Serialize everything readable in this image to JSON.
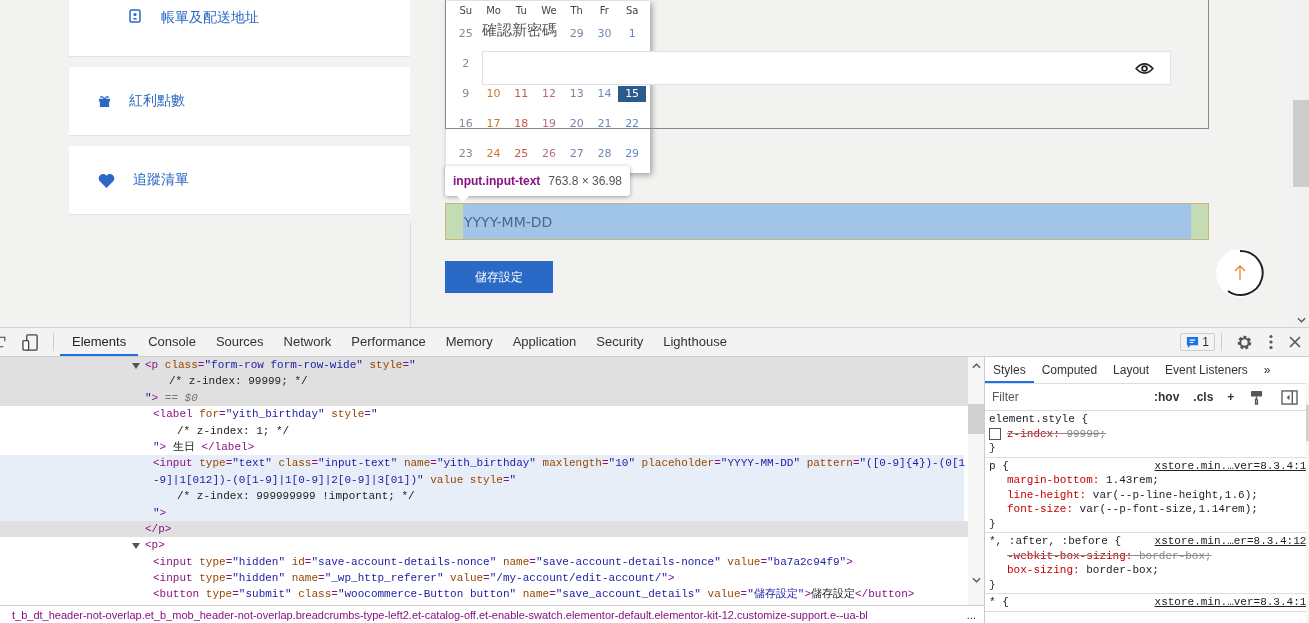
{
  "sidebar": {
    "items": [
      {
        "kind": "subitem",
        "label": "帳單及配送地址"
      },
      {
        "kind": "item",
        "label": "紅利點數"
      },
      {
        "kind": "item",
        "label": "追蹤清單"
      }
    ]
  },
  "password_section": {
    "label": "確認新密碼"
  },
  "calendar": {
    "weekdays": [
      "Su",
      "Mo",
      "Tu",
      "We",
      "Th",
      "Fr",
      "Sa"
    ],
    "weeks": [
      [
        {
          "kind": "day",
          "d": "25",
          "selected": false
        },
        {
          "kind": "covered"
        },
        {
          "kind": "covered"
        },
        {
          "kind": "covered"
        },
        {
          "kind": "day",
          "d": "29",
          "selected": false
        },
        {
          "kind": "day",
          "d": "30",
          "selected": false
        },
        {
          "kind": "day",
          "d": "1",
          "selected": false
        }
      ],
      [
        {
          "kind": "day",
          "d": "2",
          "selected": false
        }
      ],
      [
        {
          "kind": "day",
          "d": "9",
          "selected": false
        },
        {
          "kind": "day",
          "d": "10",
          "selected": false
        },
        {
          "kind": "day",
          "d": "11",
          "selected": false
        },
        {
          "kind": "day",
          "d": "12",
          "selected": false
        },
        {
          "kind": "day",
          "d": "13",
          "selected": false
        },
        {
          "kind": "day",
          "d": "14",
          "selected": false
        },
        {
          "kind": "day",
          "d": "15",
          "selected": true
        }
      ],
      [
        {
          "kind": "day",
          "d": "16",
          "selected": false
        },
        {
          "kind": "day",
          "d": "17",
          "selected": false
        },
        {
          "kind": "day",
          "d": "18",
          "selected": false
        },
        {
          "kind": "day",
          "d": "19",
          "selected": false
        },
        {
          "kind": "day",
          "d": "20",
          "selected": false
        },
        {
          "kind": "day",
          "d": "21",
          "selected": false
        },
        {
          "kind": "day",
          "d": "22",
          "selected": false
        }
      ],
      [
        {
          "kind": "day",
          "d": "23",
          "selected": false
        },
        {
          "kind": "day",
          "d": "24",
          "selected": false
        },
        {
          "kind": "day",
          "d": "25",
          "selected": false
        },
        {
          "kind": "day",
          "d": "26",
          "selected": false
        },
        {
          "kind": "day",
          "d": "27",
          "selected": false
        },
        {
          "kind": "day",
          "d": "28",
          "selected": false
        },
        {
          "kind": "day",
          "d": "29",
          "selected": false
        }
      ]
    ]
  },
  "inspect_tooltip": {
    "selector": "input.input-text",
    "size": "763.8 × 36.98"
  },
  "birthday_field": {
    "placeholder": "YYYY-MM-DD"
  },
  "save_button": {
    "label": "儲存設定"
  },
  "devtools": {
    "tabs": [
      {
        "label": "Elements",
        "selected": true
      },
      {
        "label": "Console",
        "selected": false
      },
      {
        "label": "Sources",
        "selected": false
      },
      {
        "label": "Network",
        "selected": false
      },
      {
        "label": "Performance",
        "selected": false
      },
      {
        "label": "Memory",
        "selected": false
      },
      {
        "label": "Application",
        "selected": false
      },
      {
        "label": "Security",
        "selected": false
      },
      {
        "label": "Lighthouse",
        "selected": false
      }
    ],
    "issues_count": "1",
    "dom": [
      {
        "expanded": true,
        "selected": true,
        "hovered": false,
        "lines": [
          {
            "kind": "code",
            "tokens": [
              {
                "kind": "tag",
                "text": "<p "
              },
              {
                "kind": "attr",
                "text": "class"
              },
              {
                "kind": "tag",
                "text": "="
              },
              {
                "kind": "val",
                "text": "\"form-row form-row-wide\" "
              },
              {
                "kind": "attr",
                "text": "style"
              },
              {
                "kind": "tag",
                "text": "="
              },
              {
                "kind": "val",
                "text": "\""
              }
            ]
          },
          {
            "kind": "comment",
            "tokens": [
              {
                "kind": "txt",
                "text": "/* z-index: 99999; */"
              }
            ]
          },
          {
            "kind": "code",
            "tokens": [
              {
                "kind": "val",
                "text": "\""
              },
              {
                "kind": "tag",
                "text": ">"
              },
              {
                "kind": "dim",
                "text": " == $0"
              }
            ]
          }
        ],
        "children": [
          {
            "selected": false,
            "hovered": false,
            "lines": [
              {
                "kind": "code",
                "tokens": [
                  {
                    "kind": "tag",
                    "text": "<label "
                  },
                  {
                    "kind": "attr",
                    "text": "for"
                  },
                  {
                    "kind": "tag",
                    "text": "="
                  },
                  {
                    "kind": "val",
                    "text": "\"yith_birthday\" "
                  },
                  {
                    "kind": "attr",
                    "text": "style"
                  },
                  {
                    "kind": "tag",
                    "text": "="
                  },
                  {
                    "kind": "val",
                    "text": "\""
                  }
                ]
              },
              {
                "kind": "comment",
                "tokens": [
                  {
                    "kind": "txt",
                    "text": "/* z-index: 1; */"
                  }
                ]
              },
              {
                "kind": "code",
                "tokens": [
                  {
                    "kind": "val",
                    "text": "\""
                  },
                  {
                    "kind": "tag",
                    "text": ">"
                  },
                  {
                    "kind": "txt",
                    "text": " 生日 "
                  },
                  {
                    "kind": "tag",
                    "text": "</label>"
                  }
                ]
              }
            ]
          },
          {
            "selected": false,
            "hovered": true,
            "lines": [
              {
                "kind": "code",
                "tokens": [
                  {
                    "kind": "tag",
                    "text": "<input "
                  },
                  {
                    "kind": "attr",
                    "text": "type"
                  },
                  {
                    "kind": "tag",
                    "text": "="
                  },
                  {
                    "kind": "val",
                    "text": "\"text\" "
                  },
                  {
                    "kind": "attr",
                    "text": "class"
                  },
                  {
                    "kind": "tag",
                    "text": "="
                  },
                  {
                    "kind": "val",
                    "text": "\"input-text\" "
                  },
                  {
                    "kind": "attr",
                    "text": "name"
                  },
                  {
                    "kind": "tag",
                    "text": "="
                  },
                  {
                    "kind": "val",
                    "text": "\"yith_birthday\" "
                  },
                  {
                    "kind": "attr",
                    "text": "maxlength"
                  },
                  {
                    "kind": "tag",
                    "text": "="
                  },
                  {
                    "kind": "val",
                    "text": "\"10\" "
                  },
                  {
                    "kind": "attr",
                    "text": "placeholder"
                  },
                  {
                    "kind": "tag",
                    "text": "="
                  },
                  {
                    "kind": "val",
                    "text": "\"YYYY-MM-DD\" "
                  },
                  {
                    "kind": "attr",
                    "text": "pattern"
                  },
                  {
                    "kind": "tag",
                    "text": "="
                  },
                  {
                    "kind": "val",
                    "text": "\"([0-9]{4})-(0[1"
                  }
                ]
              },
              {
                "kind": "code",
                "tokens": [
                  {
                    "kind": "val",
                    "text": "-9]|1[012])-(0[1-9]|1[0-9]|2[0-9]|3[01])\" "
                  },
                  {
                    "kind": "attr",
                    "text": "value style"
                  },
                  {
                    "kind": "tag",
                    "text": "="
                  },
                  {
                    "kind": "val",
                    "text": "\""
                  }
                ]
              },
              {
                "kind": "comment",
                "tokens": [
                  {
                    "kind": "txt",
                    "text": "/* z-index: 999999999 !important; */"
                  }
                ]
              },
              {
                "kind": "code",
                "tokens": [
                  {
                    "kind": "val",
                    "text": "\""
                  },
                  {
                    "kind": "tag",
                    "text": ">"
                  }
                ]
              }
            ]
          }
        ],
        "closing": [
          {
            "kind": "tag",
            "text": "</p>"
          }
        ]
      },
      {
        "expanded": true,
        "selected": false,
        "hovered": false,
        "lines": [
          {
            "kind": "code",
            "tokens": [
              {
                "kind": "tag",
                "text": "<p>"
              }
            ]
          }
        ],
        "children": [
          {
            "selected": false,
            "hovered": false,
            "lines": [
              {
                "kind": "code",
                "tokens": [
                  {
                    "kind": "tag",
                    "text": "<input "
                  },
                  {
                    "kind": "attr",
                    "text": "type"
                  },
                  {
                    "kind": "tag",
                    "text": "="
                  },
                  {
                    "kind": "val",
                    "text": "\"hidden\" "
                  },
                  {
                    "kind": "attr",
                    "text": "id"
                  },
                  {
                    "kind": "tag",
                    "text": "="
                  },
                  {
                    "kind": "val",
                    "text": "\"save-account-details-nonce\" "
                  },
                  {
                    "kind": "attr",
                    "text": "name"
                  },
                  {
                    "kind": "tag",
                    "text": "="
                  },
                  {
                    "kind": "val",
                    "text": "\"save-account-details-nonce\" "
                  },
                  {
                    "kind": "attr",
                    "text": "value"
                  },
                  {
                    "kind": "tag",
                    "text": "="
                  },
                  {
                    "kind": "val",
                    "text": "\"ba7a2c94f9\""
                  },
                  {
                    "kind": "tag",
                    "text": ">"
                  }
                ]
              }
            ]
          },
          {
            "selected": false,
            "hovered": false,
            "lines": [
              {
                "kind": "code",
                "tokens": [
                  {
                    "kind": "tag",
                    "text": "<input "
                  },
                  {
                    "kind": "attr",
                    "text": "type"
                  },
                  {
                    "kind": "tag",
                    "text": "="
                  },
                  {
                    "kind": "val",
                    "text": "\"hidden\" "
                  },
                  {
                    "kind": "attr",
                    "text": "name"
                  },
                  {
                    "kind": "tag",
                    "text": "="
                  },
                  {
                    "kind": "val",
                    "text": "\"_wp_http_referer\" "
                  },
                  {
                    "kind": "attr",
                    "text": "value"
                  },
                  {
                    "kind": "tag",
                    "text": "="
                  },
                  {
                    "kind": "val",
                    "text": "\"/my-account/edit-account/\""
                  },
                  {
                    "kind": "tag",
                    "text": ">"
                  }
                ]
              }
            ]
          },
          {
            "selected": false,
            "hovered": false,
            "lines": [
              {
                "kind": "code",
                "tokens": [
                  {
                    "kind": "tag",
                    "text": "<button "
                  },
                  {
                    "kind": "attr",
                    "text": "type"
                  },
                  {
                    "kind": "tag",
                    "text": "="
                  },
                  {
                    "kind": "val",
                    "text": "\"submit\" "
                  },
                  {
                    "kind": "attr",
                    "text": "class"
                  },
                  {
                    "kind": "tag",
                    "text": "="
                  },
                  {
                    "kind": "val",
                    "text": "\"woocommerce-Button button\" "
                  },
                  {
                    "kind": "attr",
                    "text": "name"
                  },
                  {
                    "kind": "tag",
                    "text": "="
                  },
                  {
                    "kind": "val",
                    "text": "\"save_account_details\" "
                  },
                  {
                    "kind": "attr",
                    "text": "value"
                  },
                  {
                    "kind": "tag",
                    "text": "="
                  },
                  {
                    "kind": "val",
                    "text": "\"儲存設定\""
                  },
                  {
                    "kind": "tag",
                    "text": ">"
                  },
                  {
                    "kind": "txt",
                    "text": "儲存設定"
                  },
                  {
                    "kind": "tag",
                    "text": "</button>"
                  }
                ]
              }
            ]
          }
        ]
      }
    ],
    "breadcrumb": "t_b_dt_header-not-overlap.et_b_mob_header-not-overlap.breadcrumbs-type-left2.et-catalog-off.et-enable-swatch.elementor-default.elementor-kit-12.customize-support.e--ua-bl",
    "breadcrumb_more": "...",
    "styles_tabs": [
      {
        "label": "Styles",
        "selected": true
      },
      {
        "label": "Computed",
        "selected": false
      },
      {
        "label": "Layout",
        "selected": false
      },
      {
        "label": "Event Listeners",
        "selected": false
      }
    ],
    "styles_more": "»",
    "filter": {
      "placeholder": "Filter"
    },
    "toolbar": [
      ":hov",
      ".cls",
      "+"
    ],
    "rules": [
      {
        "selector": "element.style {",
        "decls": [
          {
            "prop": "z-index:",
            "value": "99999;",
            "struck": true,
            "checked": false
          }
        ],
        "close": "}"
      },
      {
        "selector": "p {",
        "source": "xstore.min.…ver=8.3.4:1",
        "decls": [
          {
            "prop": "margin-bottom:",
            "value": "1.43rem;",
            "struck": false
          },
          {
            "prop": "line-height:",
            "value": "var(--p-line-height,1.6);",
            "struck": false
          },
          {
            "prop": "font-size:",
            "value": "var(--p-font-size,1.14rem);",
            "struck": false
          }
        ],
        "close": "}"
      },
      {
        "selector": "*, :after, :before {",
        "source": "xstore.min.…er=8.3.4:12",
        "decls": [
          {
            "prop": "-webkit-box-sizing:",
            "value": "border-box;",
            "struck": true
          },
          {
            "prop": "box-sizing:",
            "value": "border-box;",
            "struck": false
          }
        ],
        "close": "}"
      },
      {
        "selector": "* {",
        "source": "xstore.min.…ver=8.3.4:1"
      }
    ]
  }
}
